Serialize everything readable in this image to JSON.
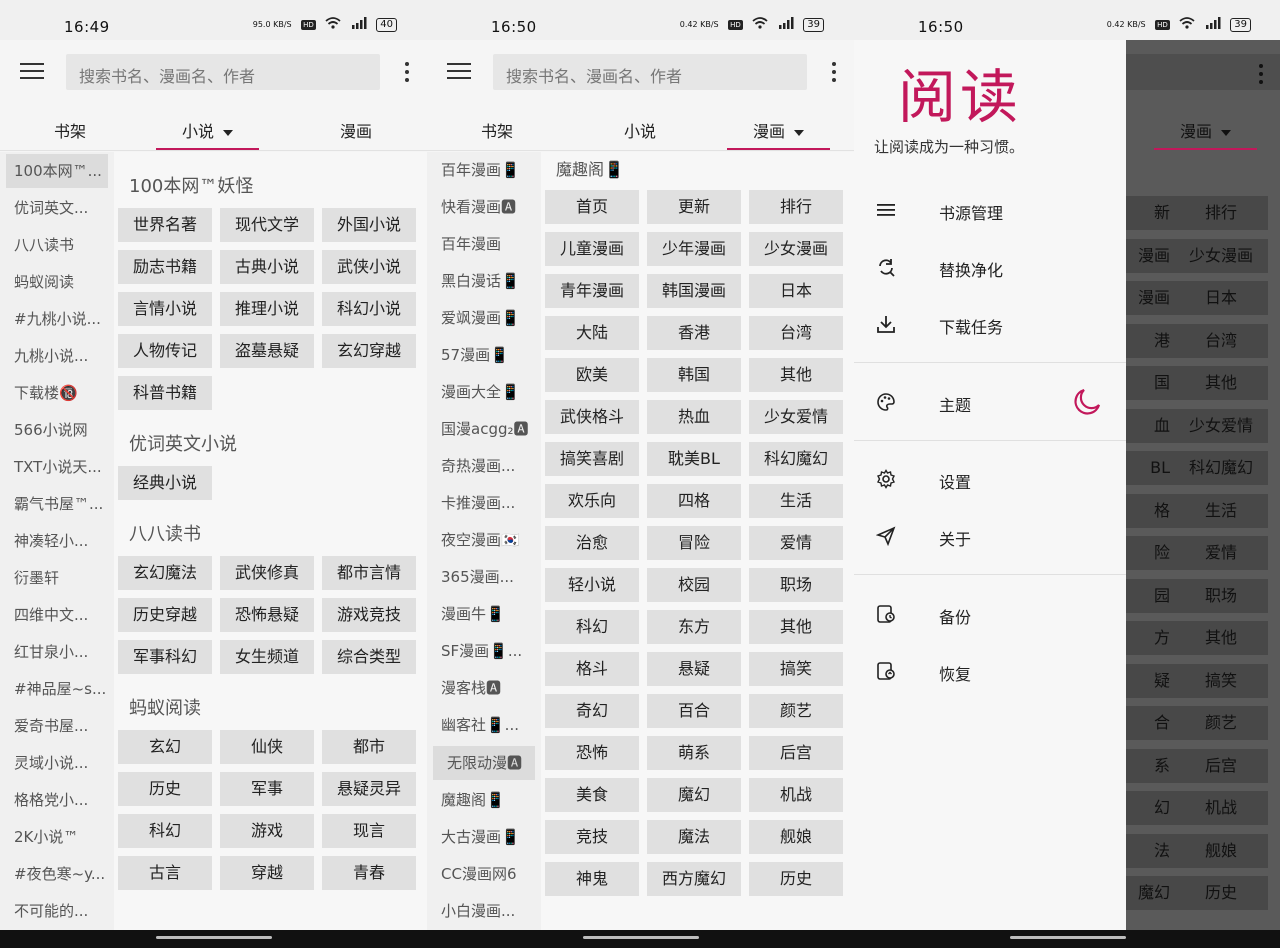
{
  "p1": {
    "time": "16:49",
    "speed": "95.0 KB/S",
    "battery": "40",
    "search_placeholder": "搜索书名、漫画名、作者",
    "tabs": [
      "书架",
      "小说",
      "漫画"
    ],
    "sources": [
      "100本网™...",
      "优词英文...",
      "八八读书",
      "蚂蚁阅读",
      "#九桃小说...",
      "九桃小说...",
      "下载楼🔞",
      "566小说网",
      "TXT小说天...",
      "霸气书屋™...",
      "神凑轻小...",
      "衍墨轩",
      "四维中文...",
      "红甘泉小...",
      "#神品屋~s...",
      "爱奇书屋...",
      "灵域小说...",
      "格格党小...",
      "2K小说™",
      "#夜色寒~y...",
      "不可能的..."
    ],
    "groups": [
      {
        "title": "100本网™妖怪",
        "items": [
          "世界名著",
          "现代文学",
          "外国小说",
          "励志书籍",
          "古典小说",
          "武侠小说",
          "言情小说",
          "推理小说",
          "科幻小说",
          "人物传记",
          "盗墓悬疑",
          "玄幻穿越",
          "科普书籍"
        ]
      },
      {
        "title": "优词英文小说",
        "items": [
          "经典小说"
        ]
      },
      {
        "title": "八八读书",
        "items": [
          "玄幻魔法",
          "武侠修真",
          "都市言情",
          "历史穿越",
          "恐怖悬疑",
          "游戏竞技",
          "军事科幻",
          "女生频道",
          "综合类型"
        ]
      },
      {
        "title": "蚂蚁阅读",
        "items": [
          "玄幻",
          "仙侠",
          "都市",
          "历史",
          "军事",
          "悬疑灵异",
          "科幻",
          "游戏",
          "现言",
          "古言",
          "穿越",
          "青春"
        ]
      }
    ]
  },
  "p2": {
    "time": "16:50",
    "speed": "0.42 KB/S",
    "battery": "39",
    "search_placeholder": "搜索书名、漫画名、作者",
    "tabs": [
      "书架",
      "小说",
      "漫画"
    ],
    "sources": [
      "百年漫画📱",
      "快看漫画🅰",
      "百年漫画",
      "黑白漫话📱",
      "爱飒漫画📱",
      "57漫画📱",
      "漫画大全📱",
      "国漫acgg₂🅰",
      "奇热漫画...",
      "卡推漫画...",
      "夜空漫画🇰🇷",
      "365漫画...",
      "漫画牛📱",
      "SF漫画📱...",
      "漫客栈🅰",
      "幽客社📱...",
      "无限动漫🅰",
      "魔趣阁📱",
      "大古漫画📱",
      "CC漫画网6",
      "小白漫画..."
    ],
    "group_title": "魔趣阁📱",
    "items": [
      "首页",
      "更新",
      "排行",
      "儿童漫画",
      "少年漫画",
      "少女漫画",
      "青年漫画",
      "韩国漫画",
      "日本",
      "大陆",
      "香港",
      "台湾",
      "欧美",
      "韩国",
      "其他",
      "武侠格斗",
      "热血",
      "少女爱情",
      "搞笑喜剧",
      "耽美BL",
      "科幻魔幻",
      "欢乐向",
      "四格",
      "生活",
      "治愈",
      "冒险",
      "爱情",
      "轻小说",
      "校园",
      "职场",
      "科幻",
      "东方",
      "其他",
      "格斗",
      "悬疑",
      "搞笑",
      "奇幻",
      "百合",
      "颜艺",
      "恐怖",
      "萌系",
      "后宫",
      "美食",
      "魔幻",
      "机战",
      "竞技",
      "魔法",
      "舰娘",
      "神鬼",
      "西方魔幻",
      "历史"
    ]
  },
  "p3": {
    "time": "16:50",
    "speed": "0.42 KB/S",
    "battery": "39",
    "logo": "阅读",
    "slogan": "让阅读成为一种习惯。",
    "bg_tab": "漫画",
    "bg_left": [
      "新",
      "漫画",
      "漫画",
      "港",
      "国",
      "血",
      "BL",
      "格",
      "险",
      "园",
      "方",
      "疑",
      "合",
      "系",
      "幻",
      "法",
      "魔幻"
    ],
    "bg_right": [
      "排行",
      "少女漫画",
      "日本",
      "台湾",
      "其他",
      "少女爱情",
      "科幻魔幻",
      "生活",
      "爱情",
      "职场",
      "其他",
      "搞笑",
      "颜艺",
      "后宫",
      "机战",
      "舰娘",
      "历史"
    ],
    "menu": [
      {
        "label": "书源管理",
        "icon": "list-icon"
      },
      {
        "label": "替换净化",
        "icon": "replace-icon"
      },
      {
        "label": "下载任务",
        "icon": "download-icon"
      },
      {
        "label": "主题",
        "icon": "palette-icon"
      },
      {
        "label": "设置",
        "icon": "gear-icon"
      },
      {
        "label": "关于",
        "icon": "send-icon"
      },
      {
        "label": "备份",
        "icon": "backup-icon"
      },
      {
        "label": "恢复",
        "icon": "restore-icon"
      }
    ],
    "accent": "#c2185b"
  }
}
